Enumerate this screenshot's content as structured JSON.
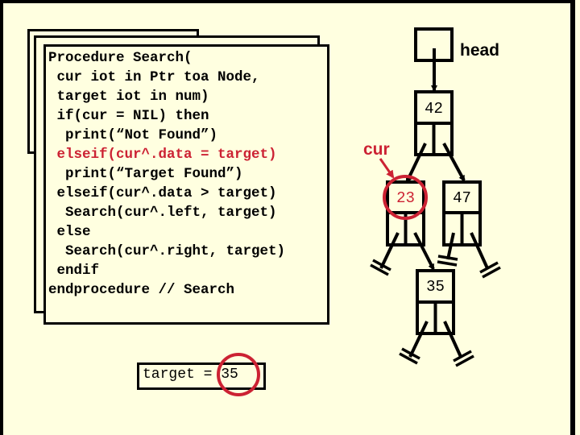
{
  "code": {
    "lines": [
      {
        "text": "Procedure Search(",
        "highlight": false
      },
      {
        "text": " cur iot in Ptr toa Node,",
        "highlight": false
      },
      {
        "text": " target iot in num)",
        "highlight": false
      },
      {
        "text": " if(cur = NIL) then",
        "highlight": false
      },
      {
        "text": "  print(“Not Found”)",
        "highlight": false
      },
      {
        "text": " elseif(cur^.data = target)",
        "highlight": true
      },
      {
        "text": "  print(“Target Found”)",
        "highlight": false
      },
      {
        "text": " elseif(cur^.data > target)",
        "highlight": false
      },
      {
        "text": "  Search(cur^.left, target)",
        "highlight": false
      },
      {
        "text": " else",
        "highlight": false
      },
      {
        "text": "  Search(cur^.right, target)",
        "highlight": false
      },
      {
        "text": " endif",
        "highlight": false
      },
      {
        "text": "endprocedure // Search",
        "highlight": false
      }
    ]
  },
  "target": {
    "label": "target = ",
    "value": "35"
  },
  "tree": {
    "head_label": "head",
    "cur_label": "cur",
    "nodes": [
      {
        "id": "n42",
        "value": "42",
        "current": false
      },
      {
        "id": "n23",
        "value": "23",
        "current": true
      },
      {
        "id": "n47",
        "value": "47",
        "current": false
      },
      {
        "id": "n35",
        "value": "35",
        "current": false
      }
    ]
  },
  "colors": {
    "background": "#ffffe0",
    "highlight": "#cc2233",
    "ink": "#000000"
  }
}
